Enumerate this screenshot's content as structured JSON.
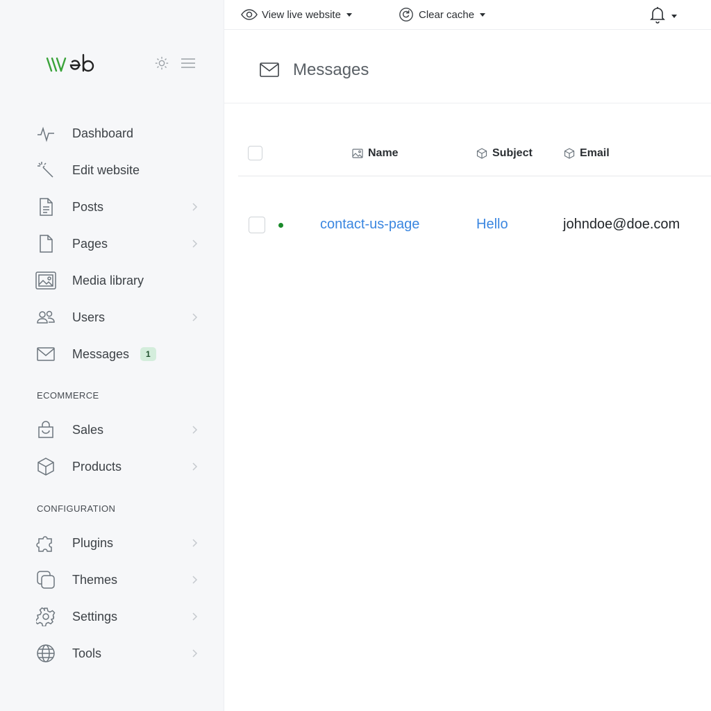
{
  "brand": {
    "logo_text": "\\\\\\Veb"
  },
  "sidebar": {
    "items": [
      {
        "label": "Dashboard",
        "icon": "pulse-icon",
        "has_chevron": false
      },
      {
        "label": "Edit website",
        "icon": "magic-wand-icon",
        "has_chevron": false
      },
      {
        "label": "Posts",
        "icon": "document-icon",
        "has_chevron": true
      },
      {
        "label": "Pages",
        "icon": "page-icon",
        "has_chevron": true
      },
      {
        "label": "Media library",
        "icon": "image-gallery-icon",
        "has_chevron": false
      },
      {
        "label": "Users",
        "icon": "users-icon",
        "has_chevron": true
      },
      {
        "label": "Messages",
        "icon": "envelope-icon",
        "has_chevron": false,
        "badge": "1"
      }
    ],
    "sections": [
      {
        "title": "ECOMMERCE",
        "items": [
          {
            "label": "Sales",
            "icon": "shopping-bag-icon",
            "has_chevron": true
          },
          {
            "label": "Products",
            "icon": "box-icon",
            "has_chevron": true
          }
        ]
      },
      {
        "title": "CONFIGURATION",
        "items": [
          {
            "label": "Plugins",
            "icon": "puzzle-icon",
            "has_chevron": true
          },
          {
            "label": "Themes",
            "icon": "layers-icon",
            "has_chevron": true
          },
          {
            "label": "Settings",
            "icon": "gear-icon",
            "has_chevron": true
          },
          {
            "label": "Tools",
            "icon": "globe-icon",
            "has_chevron": true
          }
        ]
      }
    ]
  },
  "topbar": {
    "view_live": "View live website",
    "clear_cache": "Clear cache"
  },
  "page": {
    "title": "Messages"
  },
  "table": {
    "columns": [
      "Name",
      "Subject",
      "Email"
    ],
    "rows": [
      {
        "name": "contact-us-page",
        "subject": "Hello",
        "email": "johndoe@doe.com",
        "unread": true
      }
    ]
  },
  "colors": {
    "accent": "#3a86e0",
    "logo_green": "#3aa33a",
    "badge_bg": "#d4eddc",
    "status_dot": "#1a8a2a"
  }
}
